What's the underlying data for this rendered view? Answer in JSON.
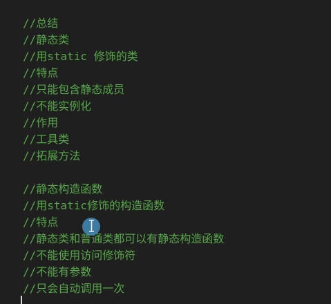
{
  "editor": {
    "comment_color": "#57a64a",
    "background_color": "#1f1f1f",
    "lines": [
      "//总结",
      "//静态类",
      "//用static 修饰的类",
      "//特点",
      "//只能包含静态成员",
      "//不能实例化",
      "//作用",
      "//工具类",
      "//拓展方法",
      "",
      "//静态构造函数",
      "//用static修饰的构造函数",
      "//特点",
      "//静态类和普通类都可以有静态构造函数",
      "//不能使用访问修饰符",
      "//不能有参数",
      "//只会自动调用一次"
    ]
  },
  "icons": {
    "mouse_cursor": "i-beam-cursor-icon",
    "click_indicator": "mouse-click-indicator"
  }
}
